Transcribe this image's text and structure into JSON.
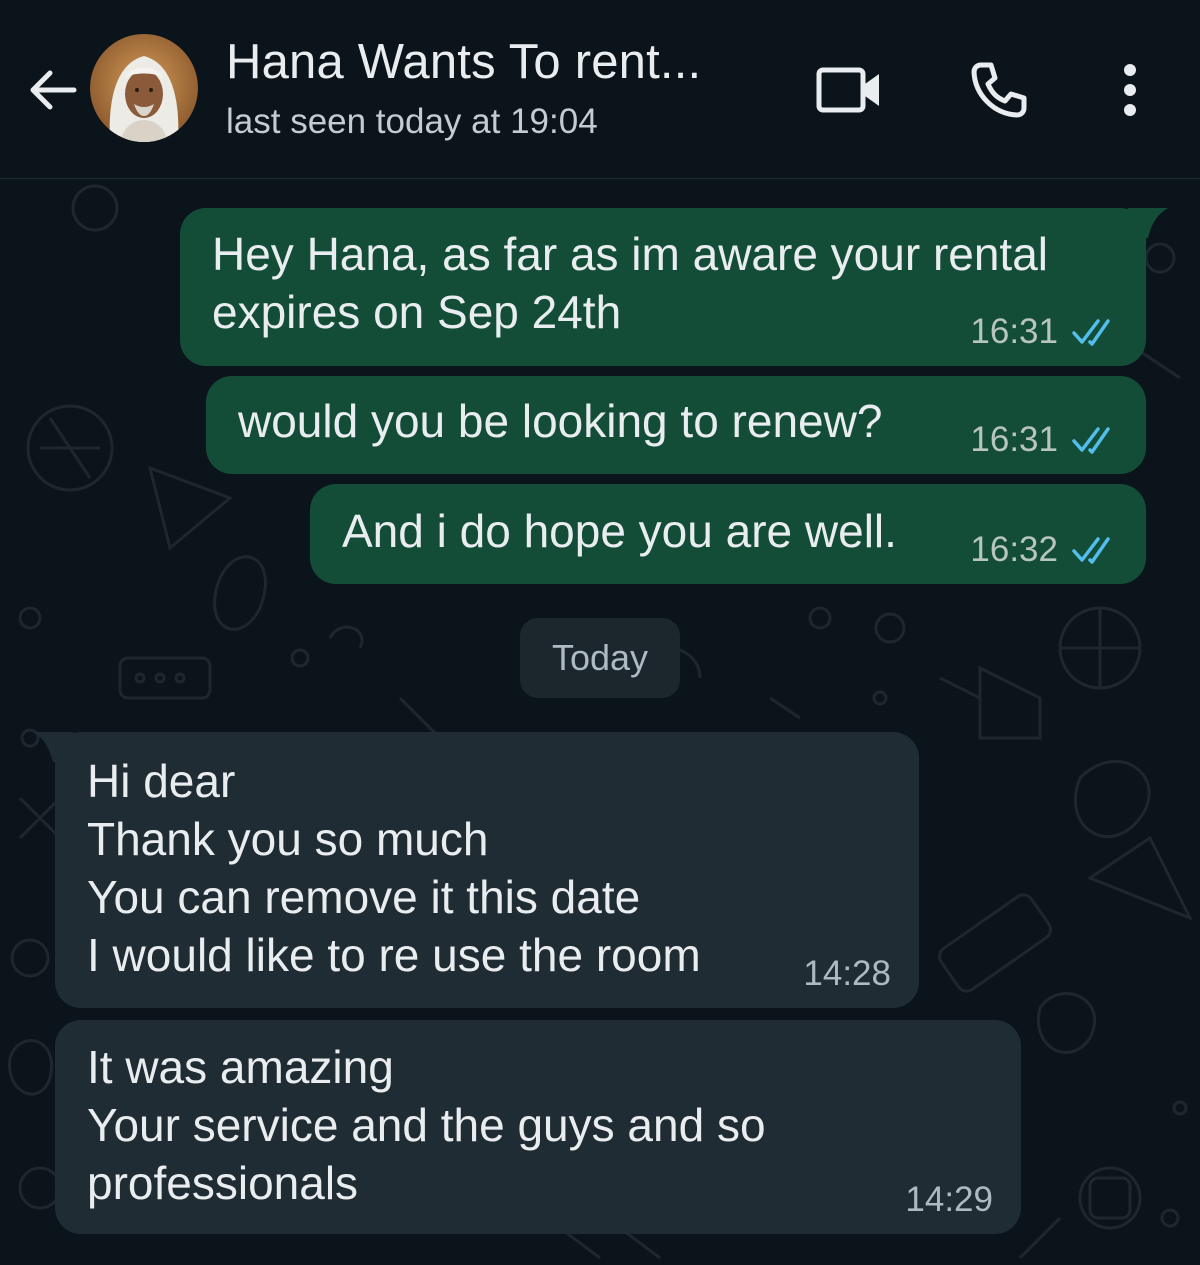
{
  "header": {
    "contact_name": "Hana Wants To rent...",
    "status": "last seen today at 19:04",
    "icons": {
      "back": "arrow-left-icon",
      "video": "video-camera-icon",
      "call": "phone-icon",
      "menu": "more-vertical-icon"
    }
  },
  "messages": [
    {
      "direction": "outgoing",
      "text": "Hey Hana, as far as im aware your rental\nexpires on Sep 24th",
      "time": "16:31",
      "status": "read"
    },
    {
      "direction": "outgoing",
      "text": "would you be looking to renew?",
      "time": "16:31",
      "status": "read"
    },
    {
      "direction": "outgoing",
      "text": "And i do hope you are well.",
      "time": "16:32",
      "status": "read"
    },
    {
      "direction": "incoming",
      "text": "Hi dear\nThank you so much\nYou can remove it this date\nI would like to re use the room",
      "time": "14:28"
    },
    {
      "direction": "incoming",
      "text": "It was amazing\nYour service and the guys and so\nprofessionals",
      "time": "14:29"
    }
  ],
  "date_separator": "Today",
  "colors": {
    "background": "#0b141a",
    "outgoing_bubble": "#134d37",
    "incoming_bubble": "#1f2c33",
    "read_ticks": "#53bdeb",
    "date_chip": "#1c272d"
  }
}
